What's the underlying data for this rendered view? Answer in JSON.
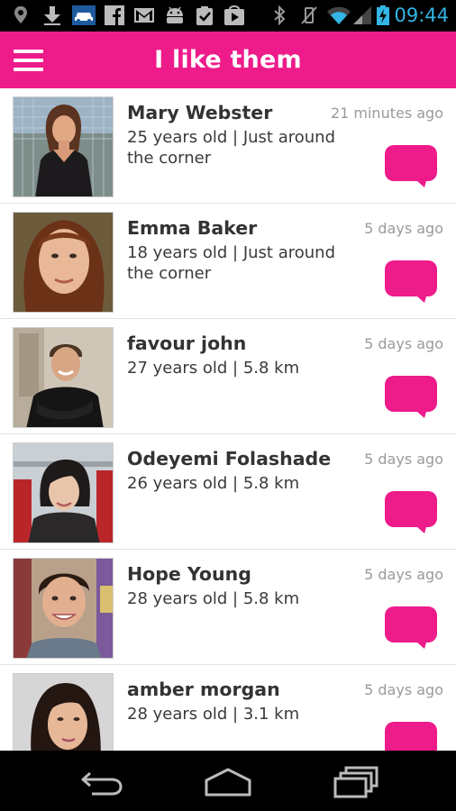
{
  "status_bar": {
    "time": "09:44",
    "time_color": "#33b5e5",
    "icons": [
      "location-pin-icon",
      "download-icon",
      "car-icon",
      "facebook-icon",
      "gmail-icon",
      "android-icon",
      "clipboard-check-icon",
      "play-store-icon",
      "bluetooth-icon",
      "vibrate-icon",
      "wifi-icon",
      "signal-icon",
      "battery-charging-icon"
    ]
  },
  "app_bar": {
    "title": "I like them",
    "menu_icon": "hamburger-menu-icon",
    "accent_color": "#ee1b8b"
  },
  "people": [
    {
      "name": "Mary Webster",
      "detail": "25 years old | Just around the corner",
      "time": "21 minutes ago"
    },
    {
      "name": "Emma Baker",
      "detail": "18 years old | Just around the corner",
      "time": "5 days ago"
    },
    {
      "name": "favour john",
      "detail": "27 years old | 5.8 km",
      "time": "5 days ago"
    },
    {
      "name": "Odeyemi Folashade",
      "detail": "26 years old | 5.8 km",
      "time": "5 days ago"
    },
    {
      "name": "Hope Young",
      "detail": "28 years old | 5.8 km",
      "time": "5 days ago"
    },
    {
      "name": "amber morgan",
      "detail": "28 years old | 3.1 km",
      "time": "5 days ago"
    }
  ],
  "nav_bar": {
    "buttons": [
      "back-icon",
      "home-icon",
      "recent-apps-icon"
    ]
  }
}
